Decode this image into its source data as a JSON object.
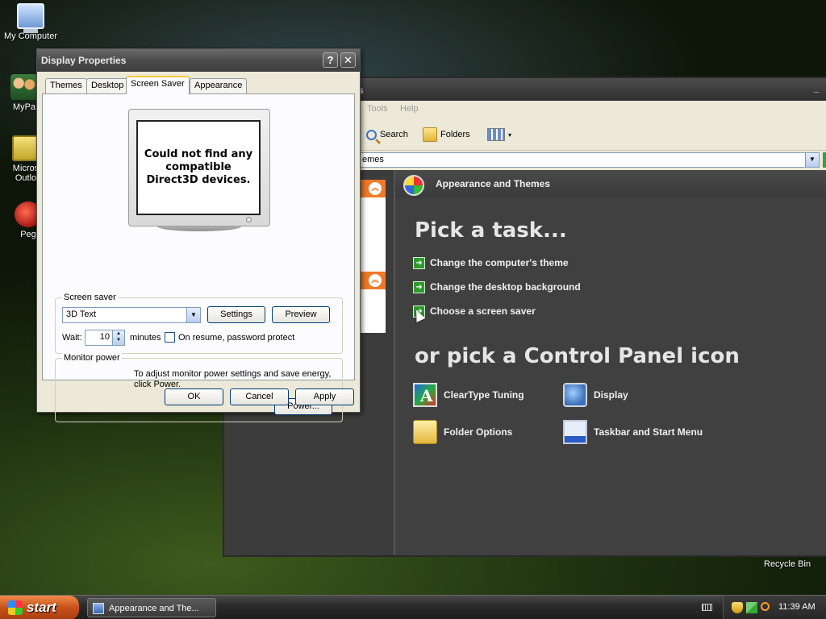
{
  "desktop": {
    "icons": [
      {
        "label": "My Computer",
        "icon": "computer-icon"
      },
      {
        "label": "MyPa",
        "icon": "people-icon"
      },
      {
        "label": "Micros\nOutlo",
        "icon": "outlook-icon"
      },
      {
        "label": "Peg",
        "icon": "pegasus-icon"
      }
    ],
    "recycle_bin_label": "Recycle Bin"
  },
  "control_panel": {
    "title": "s",
    "menu": [
      "Tools",
      "Help"
    ],
    "toolbar": {
      "search": "Search",
      "folders": "Folders"
    },
    "address": "emes",
    "category_title": "Appearance and Themes",
    "pick_task_heading": "Pick a task...",
    "tasks": [
      "Change the computer's theme",
      "Change the desktop background",
      "Choose a screen saver"
    ],
    "pick_icon_heading": "or pick a Control Panel icon",
    "icons": [
      {
        "label": "ClearType Tuning",
        "icon": "cleartype-icon"
      },
      {
        "label": "Display",
        "icon": "display-icon"
      },
      {
        "label": "Folder Options",
        "icon": "folder-options-icon"
      },
      {
        "label": "Taskbar and Start Menu",
        "icon": "taskbar-icon"
      }
    ],
    "colors": {
      "panel_header": "#f07a28",
      "task_arrow": "#2f9a2f"
    }
  },
  "display_properties": {
    "title": "Display Properties",
    "help_glyph": "?",
    "close_glyph": "✕",
    "tabs": [
      "Themes",
      "Desktop",
      "Screen Saver",
      "Appearance"
    ],
    "active_tab": "Screen Saver",
    "preview_message": "Could not find any compatible Direct3D devices.",
    "screen_saver": {
      "group_label": "Screen saver",
      "selected": "3D Text",
      "settings_label": "Settings",
      "preview_label": "Preview",
      "wait_label": "Wait:",
      "wait_value": "10",
      "minutes_label": "minutes",
      "password_label": "On resume, password protect",
      "password_checked": false
    },
    "monitor_power": {
      "group_label": "Monitor power",
      "text": "To adjust monitor power settings and save energy, click Power.",
      "power_label": "Power..."
    },
    "buttons": {
      "ok": "OK",
      "cancel": "Cancel",
      "apply": "Apply"
    }
  },
  "taskbar": {
    "start_label": "start",
    "task_item": "Appearance and The...",
    "clock": "11:39 AM"
  }
}
